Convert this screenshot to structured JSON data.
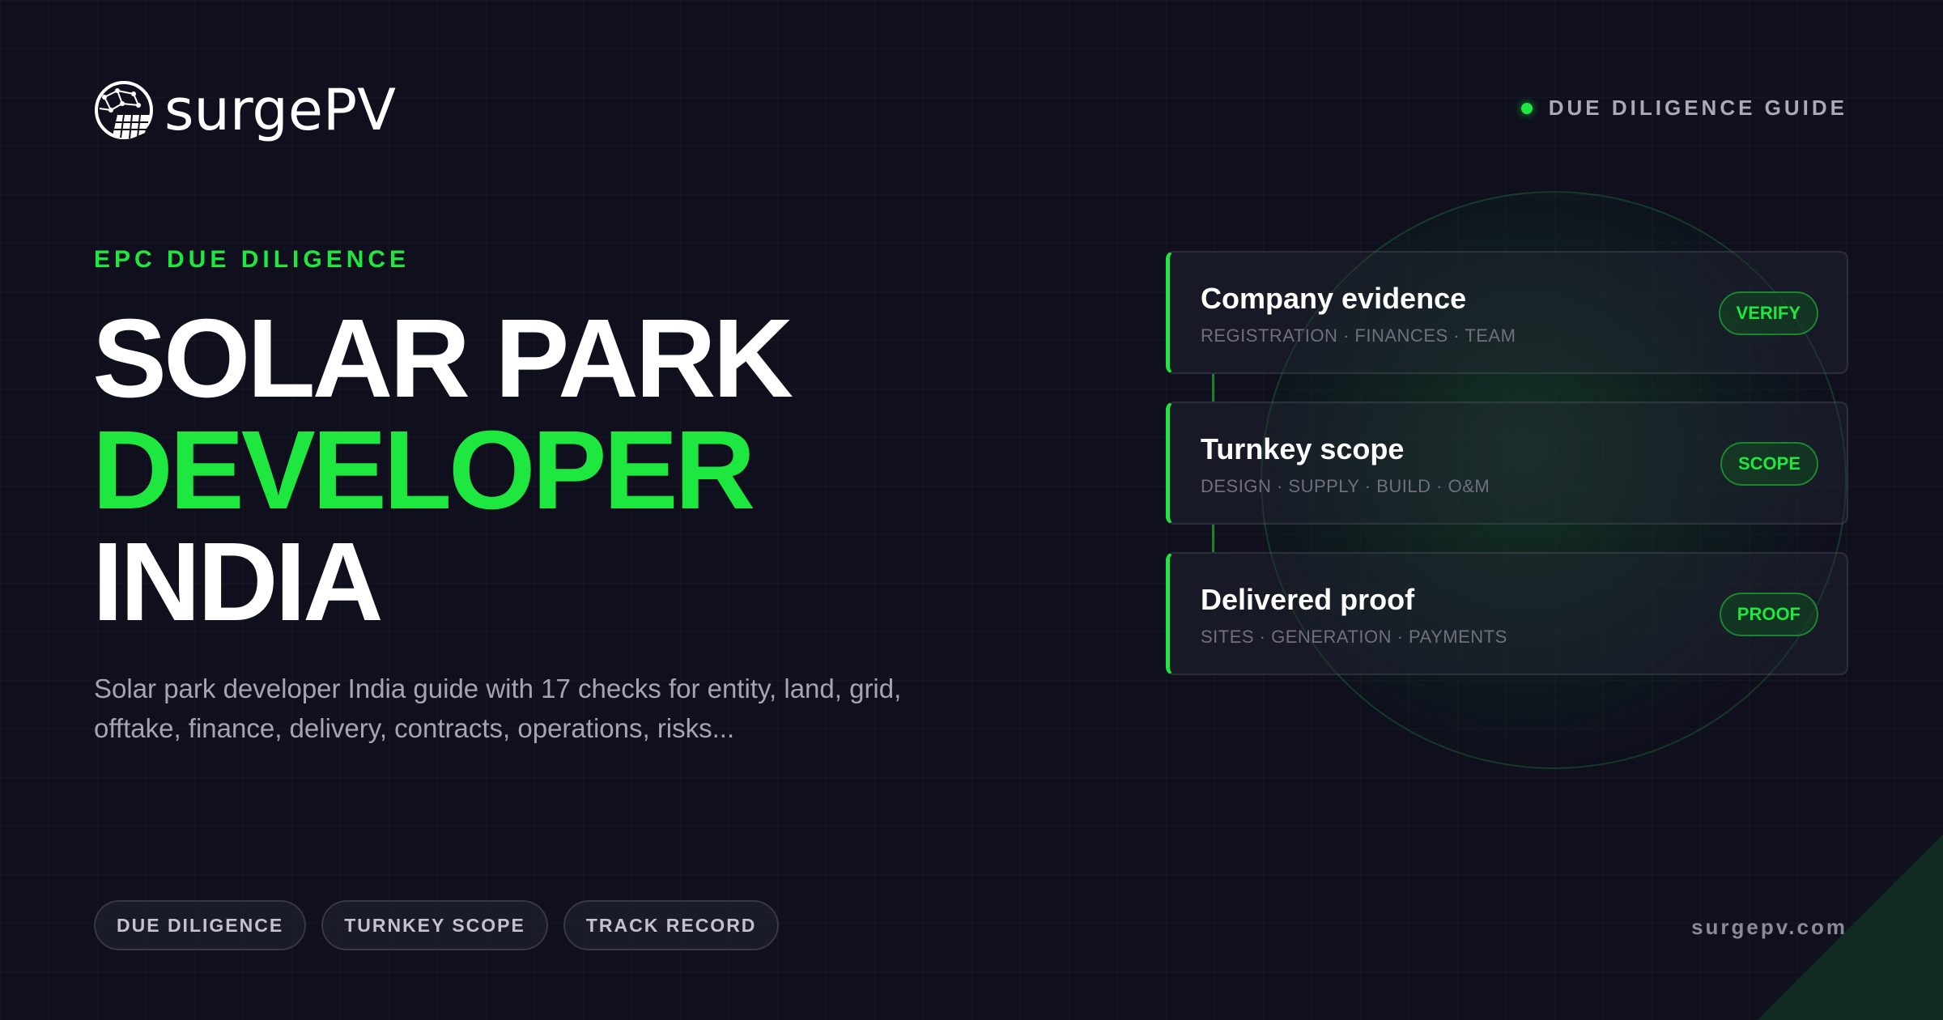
{
  "brand": {
    "name": "surgePV",
    "logo_icon": "globe-solar-panel-icon",
    "accent_color": "#1ee83f",
    "background_color": "#0f0f1d"
  },
  "top_badge": {
    "label": "DUE DILIGENCE GUIDE",
    "icon": "status-dot-icon"
  },
  "hero": {
    "eyebrow": "EPC DUE DILIGENCE",
    "title_line1": "SOLAR PARK",
    "title_line2": "DEVELOPER",
    "title_line3": "INDIA",
    "description": "Solar park developer India guide with 17 checks for entity, land, grid, offtake, finance, delivery, contracts, operations, risks..."
  },
  "cards": [
    {
      "title": "Company evidence",
      "subtitle": "REGISTRATION · FINANCES · TEAM",
      "badge": "VERIFY"
    },
    {
      "title": "Turnkey scope",
      "subtitle": "DESIGN · SUPPLY · BUILD · O&M",
      "badge": "SCOPE"
    },
    {
      "title": "Delivered proof",
      "subtitle": "SITES · GENERATION · PAYMENTS",
      "badge": "PROOF"
    }
  ],
  "tags": [
    "DUE DILIGENCE",
    "TURNKEY SCOPE",
    "TRACK RECORD"
  ],
  "footer": {
    "url": "surgepv.com"
  }
}
